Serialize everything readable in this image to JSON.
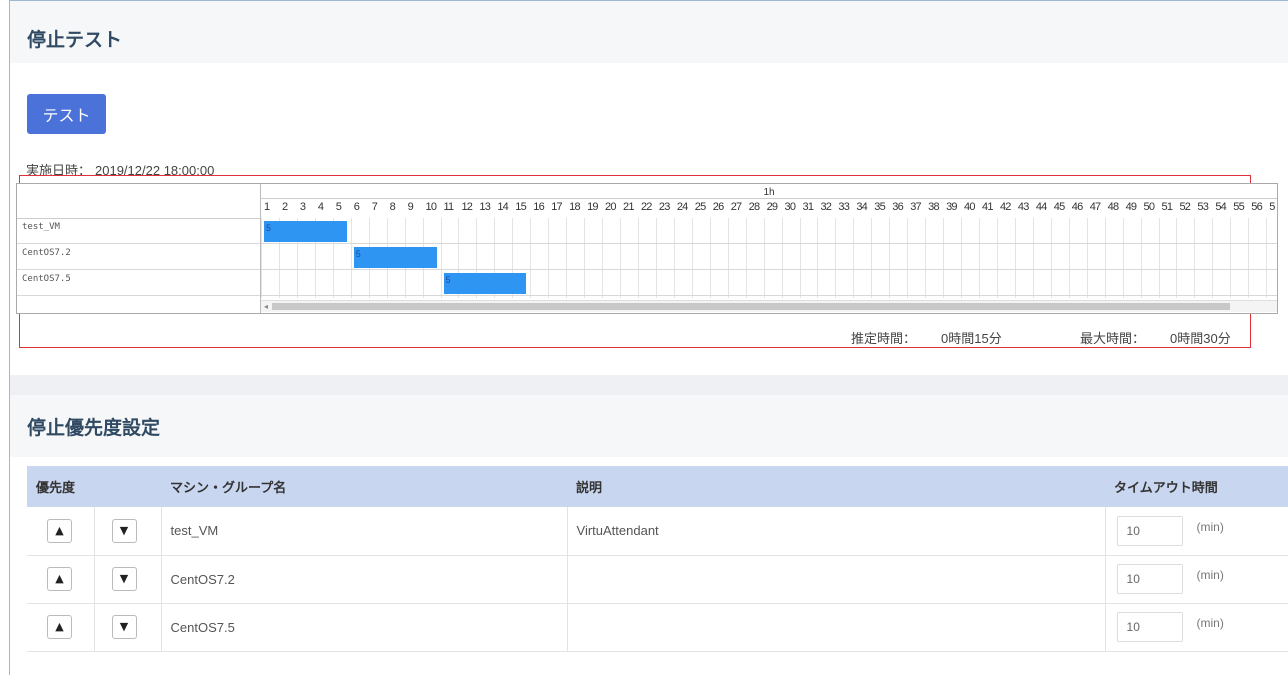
{
  "stop_test": {
    "title": "停止テスト",
    "test_button_label": "テスト",
    "execution_label": "実施日時：",
    "execution_datetime": "2019/12/22 18:00:00",
    "gantt": {
      "hour_label": "1h",
      "minute_ticks": [
        "1",
        "2",
        "3",
        "4",
        "5",
        "6",
        "7",
        "8",
        "9",
        "10",
        "11",
        "12",
        "13",
        "14",
        "15",
        "16",
        "17",
        "18",
        "19",
        "20",
        "21",
        "22",
        "23",
        "24",
        "25",
        "26",
        "27",
        "28",
        "29",
        "30",
        "31",
        "32",
        "33",
        "34",
        "35",
        "36",
        "37",
        "38",
        "39",
        "40",
        "41",
        "42",
        "43",
        "44",
        "45",
        "46",
        "47",
        "48",
        "49",
        "50",
        "51",
        "52",
        "53",
        "54",
        "55",
        "56",
        "5"
      ],
      "rows": [
        {
          "name": "test_VM",
          "start_minute": 1,
          "duration_minutes": 5,
          "bar_label": "5"
        },
        {
          "name": "CentOS7.2",
          "start_minute": 6,
          "duration_minutes": 5,
          "bar_label": "5"
        },
        {
          "name": "CentOS7.5",
          "start_minute": 11,
          "duration_minutes": 5,
          "bar_label": "5"
        }
      ],
      "bar_color": "#2f95f3"
    },
    "estimated_label": "推定時間：",
    "estimated_value": "0時間15分",
    "max_label": "最大時間：",
    "max_value": "0時間30分"
  },
  "priority_settings": {
    "title": "停止優先度設定",
    "columns": {
      "priority": "優先度",
      "name": "マシン・グループ名",
      "description": "説明",
      "timeout": "タイムアウト時間"
    },
    "up_icon": "chevron-up",
    "down_icon": "chevron-down",
    "rows": [
      {
        "name": "test_VM",
        "description": "VirtuAttendant",
        "timeout": "10",
        "unit": "(min)"
      },
      {
        "name": "CentOS7.2",
        "description": "",
        "timeout": "10",
        "unit": "(min)"
      },
      {
        "name": "CentOS7.5",
        "description": "",
        "timeout": "10",
        "unit": "(min)"
      }
    ]
  },
  "colors": {
    "accent_button": "#4a72d9",
    "table_header": "#c9d6f0",
    "highlight_border": "#e0303a",
    "title_text": "#2f4a62"
  }
}
